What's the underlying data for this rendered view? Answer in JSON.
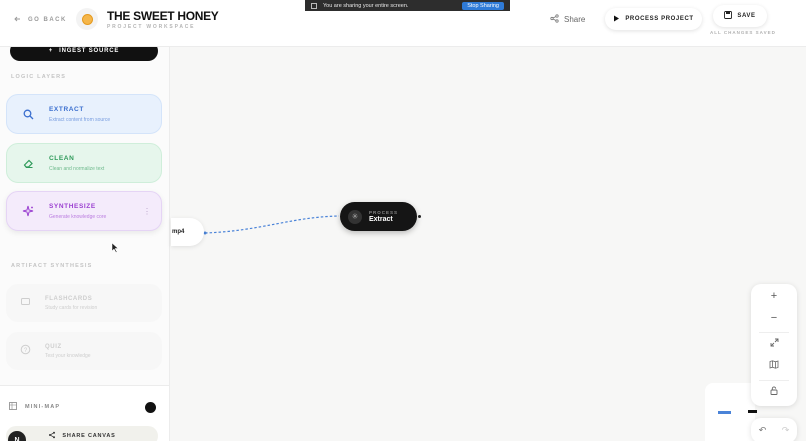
{
  "header": {
    "back_label": "GO BACK",
    "title": "THE SWEET HONEY",
    "subtitle": "PROJECT WORKSPACE",
    "share_label": "Share",
    "process_label": "PROCESS PROJECT",
    "save_label": "SAVE",
    "saved_status": "ALL CHANGES SAVED"
  },
  "screen_share_banner": {
    "message": "You are sharing your entire screen.",
    "stop_label": "Stop Sharing"
  },
  "sidebar": {
    "ingest_label": "INGEST SOURCE",
    "logic_layers_heading": "LOGIC LAYERS",
    "layers": [
      {
        "name": "EXTRACT",
        "desc": "Extract content from source",
        "icon": "search-icon"
      },
      {
        "name": "CLEAN",
        "desc": "Clean and normalize text",
        "icon": "eraser-icon"
      },
      {
        "name": "SYNTHESIZE",
        "desc": "Generate knowledge core",
        "icon": "sparkle-icon"
      }
    ],
    "artifact_heading": "ARTIFACT SYNTHESIS",
    "artifacts": [
      {
        "name": "FLASHCARDS",
        "desc": "Study cards for revision",
        "icon": "cards-icon"
      },
      {
        "name": "QUIZ",
        "desc": "Test your knowledge",
        "icon": "question-icon"
      }
    ],
    "minimap_label": "MINI-MAP",
    "share_canvas_label": "SHARE CANVAS",
    "avatar_initial": "N"
  },
  "canvas": {
    "source_node_label": "mp4",
    "process_node": {
      "kind": "PROCESS",
      "label": "Extract"
    }
  },
  "colors": {
    "extract": "#3b6fcf",
    "clean": "#2f9a5a",
    "synthesize": "#9a3fd0",
    "accent_honey": "#f5b64a",
    "stop_sharing": "#2f7bd8"
  }
}
